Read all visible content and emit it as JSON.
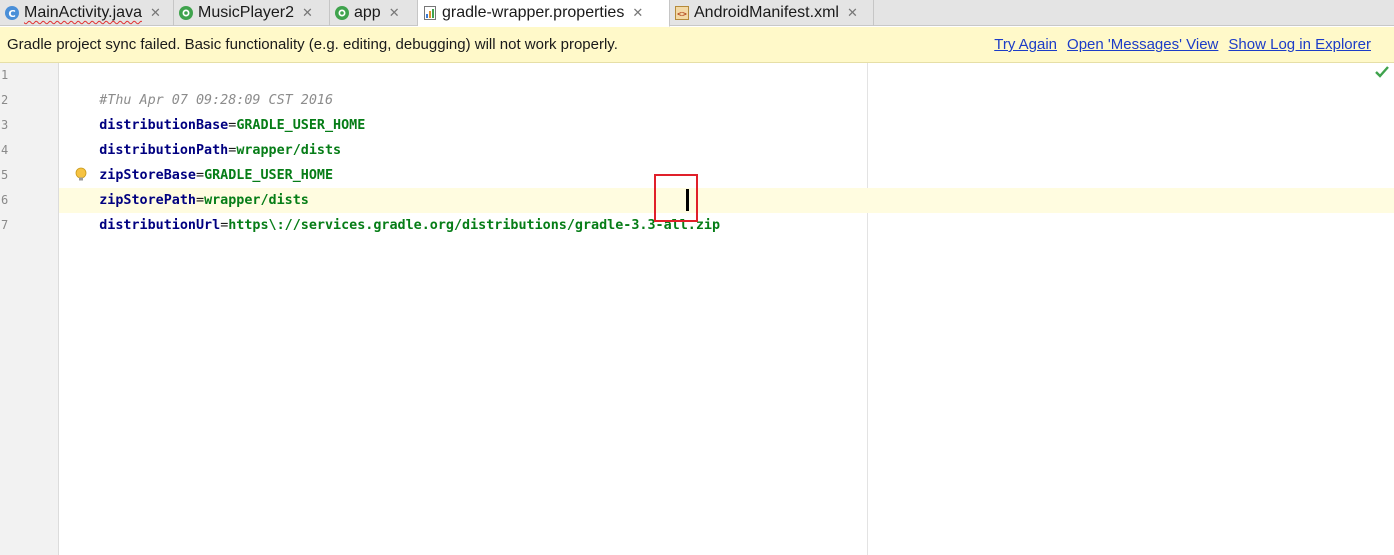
{
  "tabs": [
    {
      "label": "MainActivity.java",
      "icon": "java-class-icon",
      "close": "✕",
      "error": true
    },
    {
      "label": "MusicPlayer2",
      "icon": "gradle-module-icon",
      "close": "✕"
    },
    {
      "label": "app",
      "icon": "gradle-module-icon",
      "close": "✕"
    },
    {
      "label": "gradle-wrapper.properties",
      "icon": "properties-file-icon",
      "close": "✕",
      "active": true
    },
    {
      "label": "AndroidManifest.xml",
      "icon": "xml-file-icon",
      "close": "✕"
    }
  ],
  "notification": {
    "message": "Gradle project sync failed. Basic functionality (e.g. editing, debugging) will not work properly.",
    "links": [
      "Try Again",
      "Open 'Messages' View",
      "Show Log in Explorer"
    ]
  },
  "editor": {
    "line_numbers": [
      "1",
      "2",
      "3",
      "4",
      "5",
      "6",
      "7"
    ],
    "lines": [
      {
        "comment": "#Thu Apr 07 09:28:09 CST 2016"
      },
      {
        "key": "distributionBase",
        "eq": "=",
        "value": "GRADLE_USER_HOME"
      },
      {
        "key": "distributionPath",
        "eq": "=",
        "value": "wrapper/dists"
      },
      {
        "key": "zipStoreBase",
        "eq": "=",
        "value": "GRADLE_USER_HOME"
      },
      {
        "key": "zipStorePath",
        "eq": "=",
        "value": "wrapper/dists"
      },
      {
        "key": "distributionUrl",
        "eq": "=",
        "value": "https\\://services.gradle.org/distributions/gradle-3.3-all.zip"
      }
    ],
    "intention_icon": "lightbulb-icon",
    "status_icon": "checkmark-icon",
    "highlight_color": "#e0202a"
  }
}
